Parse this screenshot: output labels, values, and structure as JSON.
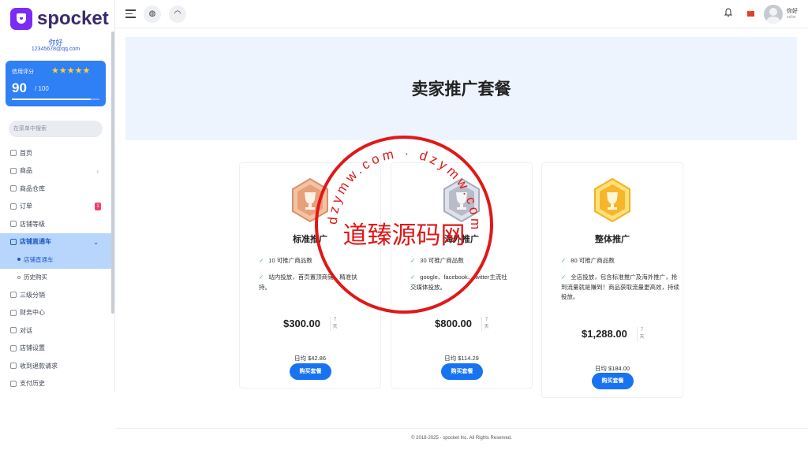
{
  "brand": {
    "name": "spocket",
    "color": "#7b2cf4"
  },
  "user": {
    "greeting": "你好",
    "email": "12345678@qq.com",
    "name": "你好",
    "role": "seller"
  },
  "credit": {
    "label": "信用评分",
    "score": "90",
    "max": "/ 100",
    "stars": "★★★★★",
    "rating": 4.5,
    "progress": 0.9
  },
  "sidebar": {
    "search_placeholder": "在菜单中搜索",
    "items": [
      {
        "label": "首页"
      },
      {
        "label": "商品",
        "chevron": "›"
      },
      {
        "label": "商品仓库"
      },
      {
        "label": "订单",
        "badge": "1"
      },
      {
        "label": "店铺等级"
      },
      {
        "label": "店铺直通车",
        "chevron": "⌄"
      },
      {
        "label": "店铺直通车"
      },
      {
        "label": "历史购买"
      },
      {
        "label": "三级分销"
      },
      {
        "label": "财务中心"
      },
      {
        "label": "对话"
      },
      {
        "label": "店铺设置"
      },
      {
        "label": "收到退款请求"
      },
      {
        "label": "支付历史"
      }
    ]
  },
  "topbar": {
    "globe_icon": "globe-icon",
    "support_icon": "headset-icon",
    "bell_icon": "bell-icon",
    "flag": "cn-flag"
  },
  "page": {
    "title": "卖家推广套餐"
  },
  "plans": [
    {
      "title": "标准推广",
      "medal": "bronze",
      "features": [
        "10 可推广商品数",
        "站内投放，首页置顶商铺，精准扶持。"
      ],
      "price": "$300.00",
      "days_num": "7",
      "days_unit": "天",
      "daily": "日均 $42.86",
      "buy": "购买套餐"
    },
    {
      "title": "海外推广",
      "medal": "silver",
      "features": [
        "30 可推广商品数",
        "google、facebook、twitter主流社交媒体投放。"
      ],
      "price": "$800.00",
      "days_num": "7",
      "days_unit": "天",
      "daily": "日均 $114.29",
      "buy": "购买套餐"
    },
    {
      "title": "整体推广",
      "medal": "gold",
      "features": [
        "80 可推广商品数",
        "全店投放，包含标准推广及海外推广，抢到流量就是赚到！商品获取流量更高效，持续投放。"
      ],
      "price": "$1,288.00",
      "days_num": "7",
      "days_unit": "天",
      "daily": "日均 $184.00",
      "buy": "购买套餐"
    }
  ],
  "footer": {
    "text": "© 2018-2025 - spocket Inc. All Rights Reserved."
  },
  "watermark": {
    "center": "道臻源码网",
    "ring": "dzymw.com · dzymw.com"
  }
}
